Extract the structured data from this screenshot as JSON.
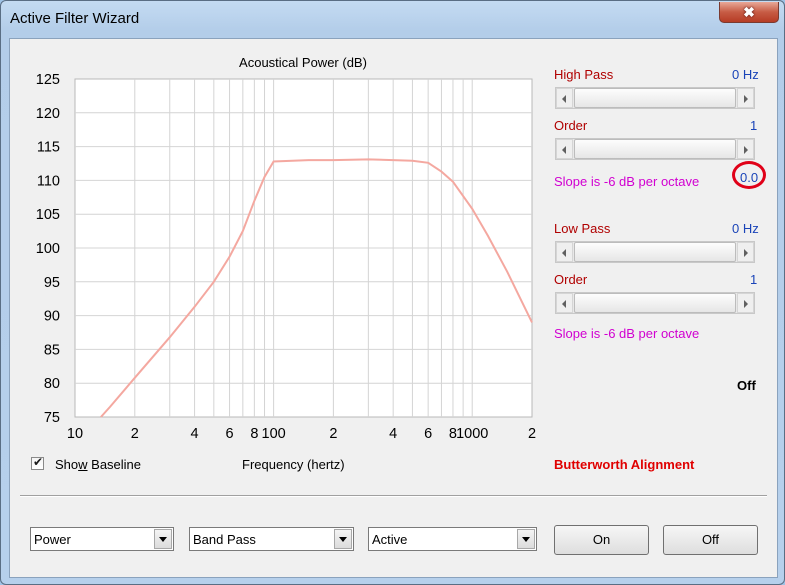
{
  "window": {
    "title": "Active Filter Wizard",
    "close_symbol": "✖"
  },
  "chart": {
    "title": "Acoustical Power (dB)",
    "xlabel": "Frequency (hertz)",
    "y_ticks": [
      "125",
      "120",
      "115",
      "110",
      "105",
      "100",
      "95",
      "90",
      "85",
      "80",
      "75"
    ],
    "x_ticks": [
      "10",
      "2",
      "4",
      "6",
      "8",
      "100",
      "2",
      "4",
      "6",
      "8",
      "1000",
      "2"
    ],
    "curve_color": "#f4a8a0"
  },
  "chart_data": {
    "type": "line",
    "title": "Acoustical Power (dB)",
    "xlabel": "Frequency (hertz)",
    "ylabel": "",
    "xscale": "log",
    "xlim": [
      10,
      2000
    ],
    "ylim": [
      75,
      125
    ],
    "grid": true,
    "series": [
      {
        "x": [
          13.5,
          15,
          20,
          30,
          40,
          50,
          60,
          70,
          80,
          90,
          100,
          150,
          200,
          300,
          400,
          500,
          600,
          700,
          800,
          1000,
          1200,
          1500,
          2000
        ],
        "y": [
          75,
          76.5,
          80.8,
          86.8,
          91.3,
          95,
          98.7,
          102.5,
          107,
          110.5,
          112.8,
          113,
          113,
          113.1,
          113,
          112.9,
          112.6,
          111.3,
          109.8,
          105.8,
          101.8,
          96.5,
          89
        ]
      }
    ]
  },
  "high_pass": {
    "label": "High Pass",
    "value": "0 Hz",
    "order_label": "Order",
    "order_value": "1",
    "slope_text": "Slope is -6 dB per octave",
    "slope_value": "0.0"
  },
  "low_pass": {
    "label": "Low Pass",
    "value": "0 Hz",
    "order_label": "Order",
    "order_value": "1",
    "slope_text": "Slope is -6 dB per octave"
  },
  "status": "Off",
  "alignment": "Butterworth Alignment",
  "show_baseline": {
    "label_pre": "Sho",
    "label_accel": "w",
    "label_post": " Baseline",
    "checked": true
  },
  "bottom": {
    "combo1": "Power",
    "combo2": "Band Pass",
    "combo3": "Active",
    "on_label": "On",
    "off_label": "Off"
  }
}
